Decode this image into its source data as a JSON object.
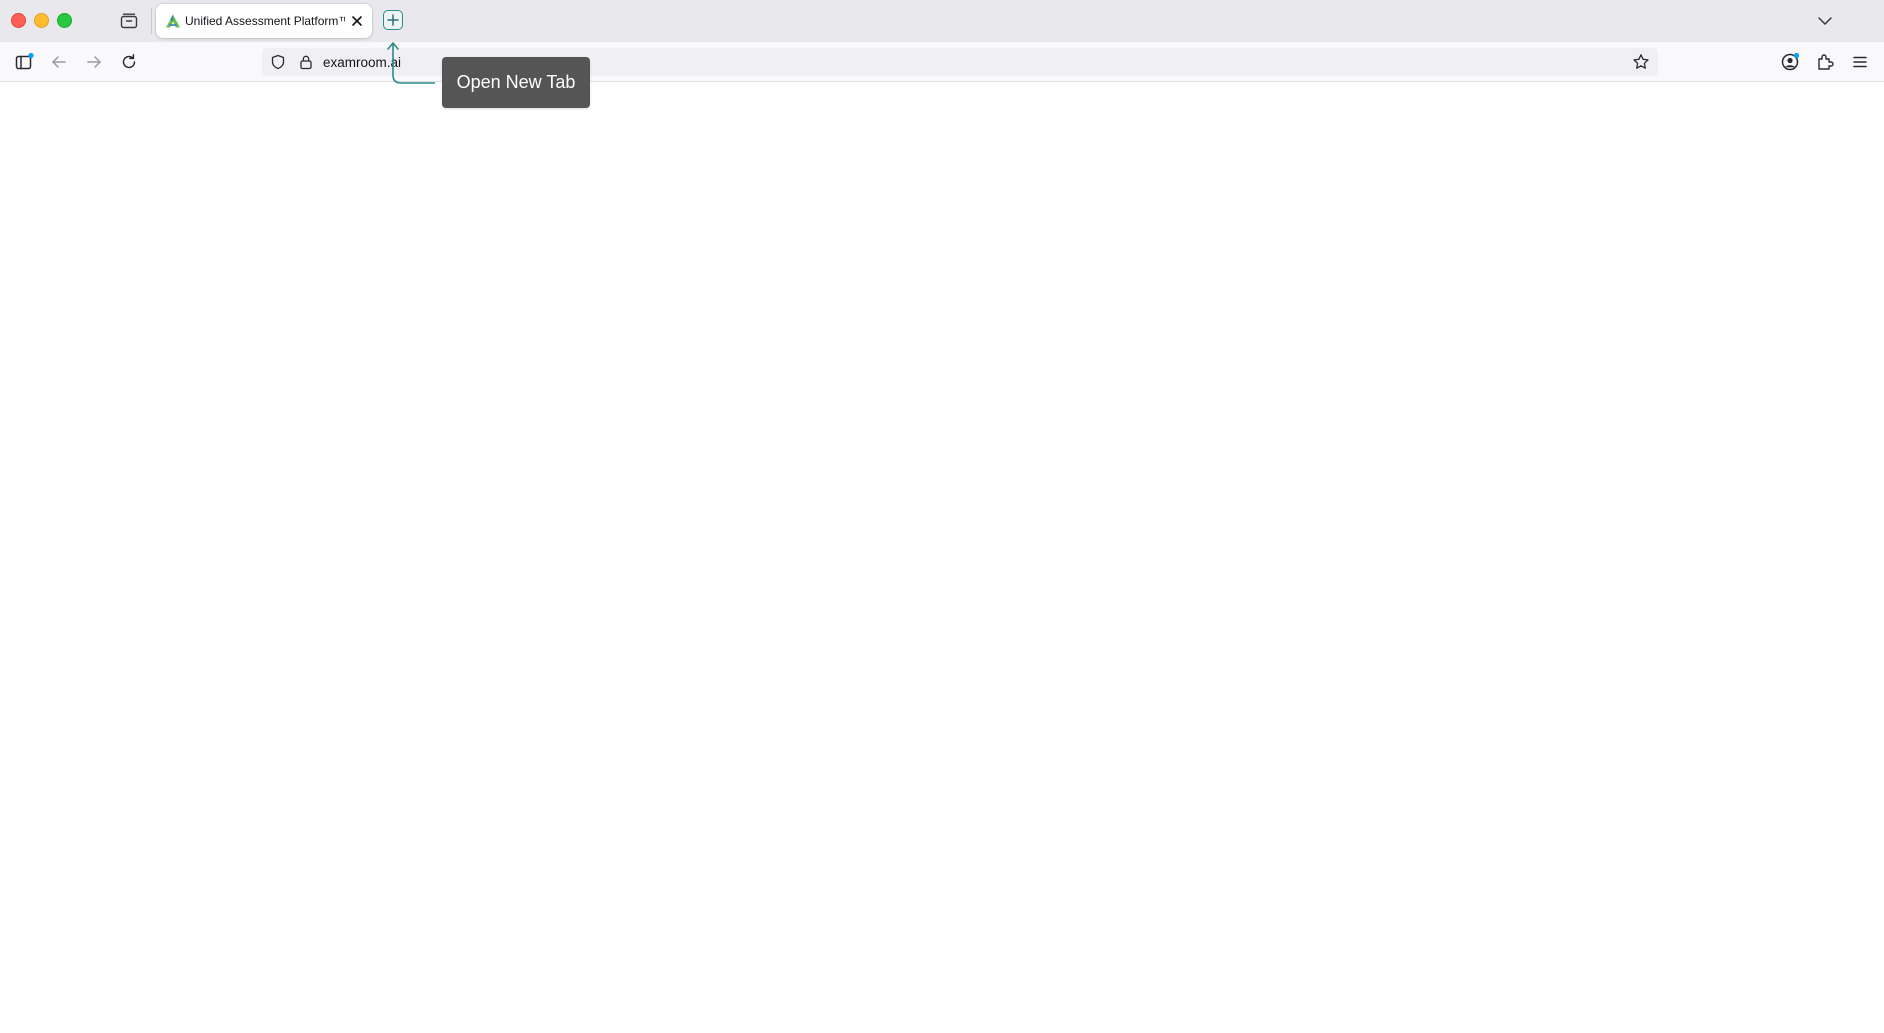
{
  "browser": {
    "tab": {
      "title": "Unified Assessment Platform™ | ExamRoom.AI",
      "favicon": "examroom-logo-icon"
    },
    "new_tab_tooltip": "Open New Tab",
    "url": "examroom.ai",
    "icons": {
      "tabs_overview": "tabs-overview-icon",
      "sidebar": "sidebar-icon",
      "back": "back-arrow-icon",
      "forward": "forward-arrow-icon",
      "reload": "reload-icon",
      "shield": "tracking-protection-icon",
      "lock": "lock-icon",
      "bookmark": "star-icon",
      "account": "account-icon",
      "extensions": "extensions-icon",
      "menu": "hamburger-menu-icon",
      "list_tabs": "chevron-down-icon",
      "new_tab": "plus-icon"
    },
    "colors": {
      "accent": "#2a8a88",
      "tooltip_bg": "#555555",
      "close": "#fe5f57",
      "minimize": "#febc2e",
      "maximize": "#28c840",
      "notification_dot": "#00a2f5"
    }
  }
}
